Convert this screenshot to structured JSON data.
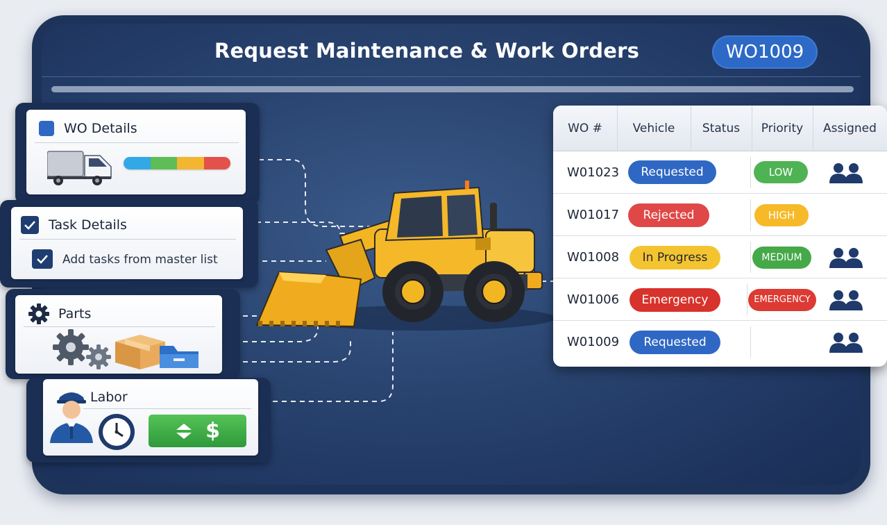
{
  "header": {
    "title": "Request Maintenance & Work Orders",
    "wo_badge": "WO1009"
  },
  "panels": {
    "wo_details": {
      "title": "WO Details",
      "icon": "truck-icon"
    },
    "task_details": {
      "title": "Task Details",
      "subtask": "Add tasks from master list"
    },
    "parts": {
      "title": "Parts",
      "icons": [
        "gears-icon",
        "box-icon",
        "tray-icon"
      ]
    },
    "labor": {
      "title": "Labor",
      "icons": [
        "technician-icon",
        "clock-icon",
        "dollar-icon"
      ],
      "money_symbol": "$"
    }
  },
  "colors": {
    "accent_blue": "#2d69c6",
    "status_requested": "#2f68c4",
    "status_rejected": "#e04848",
    "status_in_progress": "#f4c430",
    "status_emergency": "#d7322b",
    "priority_low": "#4fb354",
    "priority_high": "#f6b928",
    "priority_medium": "#45a849",
    "priority_emergency": "#dc3a32",
    "progress_segments": [
      "#33a8e6",
      "#5fbd55",
      "#f2b630",
      "#e4504a"
    ]
  },
  "table": {
    "columns": [
      "WO #",
      "Vehicle",
      "Status",
      "Priority",
      "Assigned"
    ],
    "rows": [
      {
        "wo": "W01023",
        "status": "Requested",
        "priority": "LOW",
        "assigned": true
      },
      {
        "wo": "W01017",
        "status": "Rejected",
        "priority": "HIGH",
        "assigned": false
      },
      {
        "wo": "W01008",
        "status": "In Progress",
        "priority": "MEDIUM",
        "assigned": true
      },
      {
        "wo": "W01006",
        "status": "Emergency",
        "priority": "EMERGENCY",
        "assigned": true
      },
      {
        "wo": "W01009",
        "status": "Requested",
        "priority": "",
        "assigned": true
      }
    ]
  }
}
